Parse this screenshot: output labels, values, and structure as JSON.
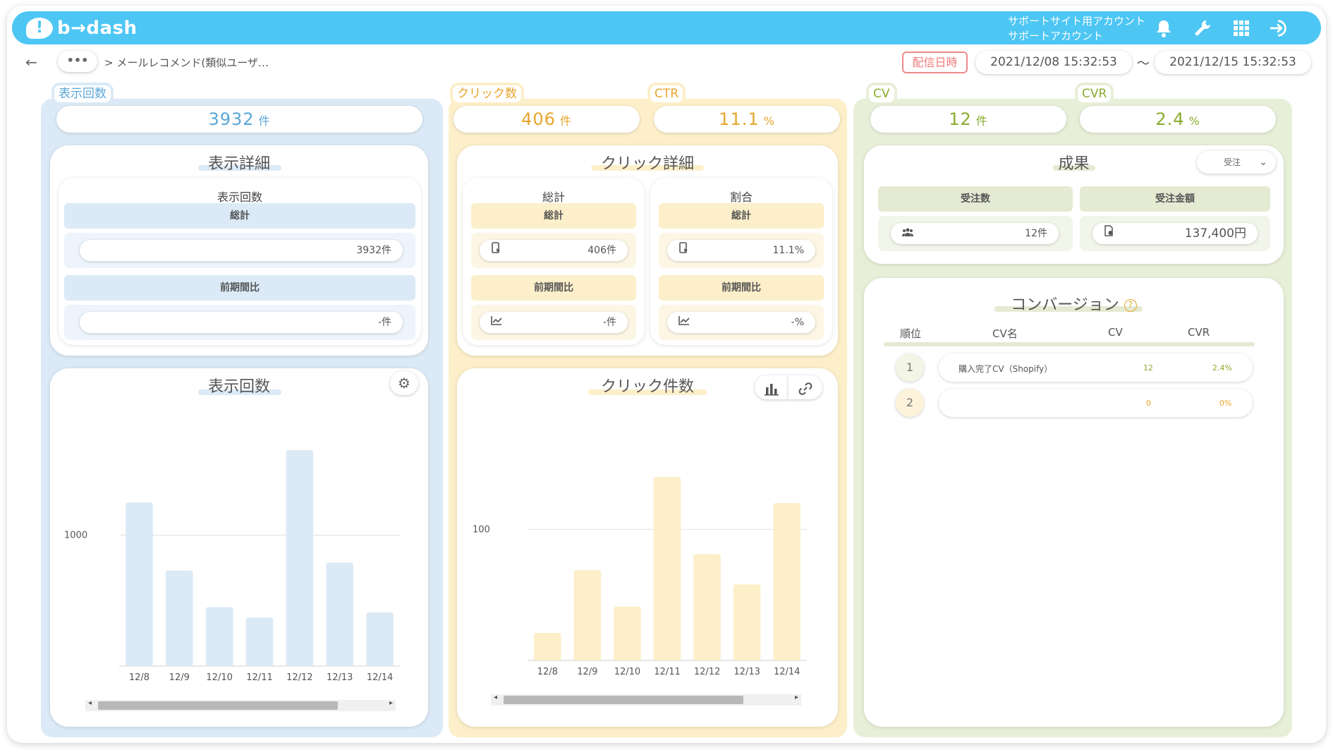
{
  "app": {
    "logo_text": "b→dash"
  },
  "account": {
    "line1": "サポートサイト用アカウント",
    "line2": "サポートアカウント"
  },
  "breadcrumb": {
    "more": "•••",
    "text": "> メールレコメンド(類似ユーザ…"
  },
  "delivery": {
    "label": "配信日時",
    "start": "2021/12/08 15:32:53",
    "separator": "〜",
    "end": "2021/12/15 15:32:53"
  },
  "metrics": {
    "impressions": {
      "label": "表示回数",
      "value": "3932",
      "unit": "件"
    },
    "clicks": {
      "label": "クリック数",
      "value": "406",
      "unit": "件"
    },
    "ctr": {
      "label": "CTR",
      "value": "11.1",
      "unit": "%"
    },
    "cv": {
      "label": "CV",
      "value": "12",
      "unit": "件"
    },
    "cvr": {
      "label": "CVR",
      "value": "2.4",
      "unit": "%"
    }
  },
  "impression_detail": {
    "title": "表示詳細",
    "sub_title": "表示回数",
    "total_label": "総計",
    "total_value": "3932件",
    "prev_label": "前期間比",
    "prev_value": "-件"
  },
  "click_detail": {
    "title": "クリック詳細",
    "left": {
      "title": "総計",
      "total_label": "総計",
      "total_value": "406件",
      "prev_label": "前期間比",
      "prev_value": "-件"
    },
    "right": {
      "title": "割合",
      "total_label": "総計",
      "total_value": "11.1%",
      "prev_label": "前期間比",
      "prev_value": "-%"
    }
  },
  "results": {
    "title": "成果",
    "select_value": "受注",
    "orders_label": "受注数",
    "orders_value": "12件",
    "amount_label": "受注金額",
    "amount_value": "137,400円"
  },
  "conversion": {
    "title": "コンバージョン",
    "help": "?",
    "headers": {
      "rank": "順位",
      "name": "CV名",
      "cv": "CV",
      "cvr": "CVR"
    },
    "rows": [
      {
        "rank": "1",
        "name": "購入完了CV（Shopify）",
        "cv": "12",
        "cvr": "2.4%"
      },
      {
        "rank": "2",
        "name": "",
        "cv": "0",
        "cvr": "0%"
      }
    ]
  },
  "chart_data": [
    {
      "type": "bar",
      "title": "表示回数",
      "categories": [
        "12/8",
        "12/9",
        "12/10",
        "12/11",
        "12/12",
        "12/13",
        "12/14"
      ],
      "values": [
        1250,
        730,
        450,
        370,
        1650,
        790,
        410
      ],
      "yticks": [
        1000
      ],
      "ylim": [
        0,
        1650
      ],
      "color": "#dceaf6"
    },
    {
      "type": "bar",
      "title": "クリック件数",
      "categories": [
        "12/8",
        "12/9",
        "12/10",
        "12/11",
        "12/12",
        "12/13",
        "12/14"
      ],
      "values": [
        21,
        69,
        41,
        140,
        81,
        58,
        120
      ],
      "yticks": [
        100
      ],
      "ylim": [
        0,
        140
      ],
      "color": "#fcefc9"
    }
  ],
  "colors": {
    "accent": "#4dc6f4",
    "impressions": "#5aa6d8",
    "clicks": "#e8a52b",
    "cv": "#8aab2e",
    "alert": "#f07a7a"
  }
}
